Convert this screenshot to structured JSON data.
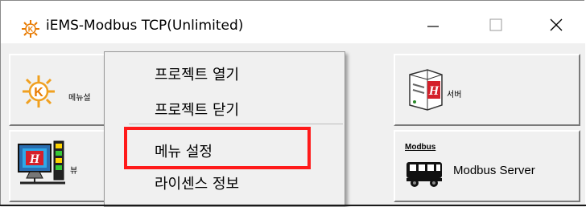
{
  "window": {
    "title": "iEMS-Modbus TCP(Unlimited)",
    "controls": {
      "minimize": "minimize-icon",
      "maximize": "maximize-icon",
      "close": "close-icon"
    }
  },
  "tiles": {
    "menu_settings": {
      "label": "메뉴설",
      "icon": "k-sun-logo-icon"
    },
    "server": {
      "label": "서버",
      "icon": "server-h-icon"
    },
    "view": {
      "label": "뷰",
      "icon": "monitor-h-icon"
    },
    "modbus_server": {
      "label": "Modbus Server",
      "badge": "Modbus",
      "icon": "bus-icon"
    }
  },
  "context_menu": {
    "items": [
      {
        "label": "프로젝트 열기"
      },
      {
        "label": "프로젝트 닫기"
      },
      {
        "label": "메뉴 설정"
      },
      {
        "label": "라이센스 정보"
      }
    ],
    "highlighted_index": 2
  },
  "colors": {
    "highlight": "#ff1a1a",
    "tile_bg": "#f0f0f0",
    "brand_orange": "#e87a00",
    "brand_red": "#d4202a"
  }
}
